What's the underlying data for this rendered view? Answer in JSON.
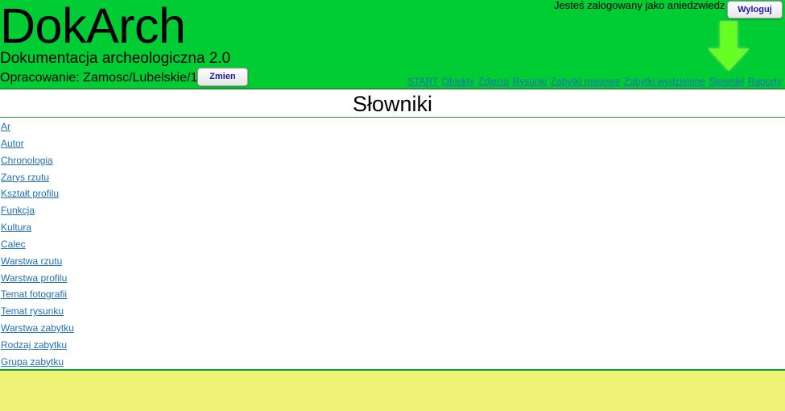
{
  "header": {
    "app_title": "DokArch",
    "app_subtitle": "Dokumentacja archeologiczna 2.0",
    "project_label": "Opracowanie: Zamosc/Lubelskie/1",
    "change_button": "Zmien",
    "user_status": "Jesteś zalogowany jako aniedzwiedz",
    "logout_button": "Wyloguj",
    "arrow_icon": "down-arrow-icon"
  },
  "nav": {
    "items": [
      {
        "label": "START"
      },
      {
        "label": "Obiekty"
      },
      {
        "label": "Zdjecia"
      },
      {
        "label": "Rysunki"
      },
      {
        "label": "Zabytki masowe"
      },
      {
        "label": "Zabytki wydzielone"
      },
      {
        "label": "Słowniki"
      },
      {
        "label": "Raporty"
      }
    ]
  },
  "main": {
    "heading": "Słowniki",
    "dictionaries": [
      "Ar",
      "Autor",
      "Chronologia",
      "Zarys rzutu",
      "Kształt profilu",
      "Funkcja",
      "Kultura",
      "Calec",
      "Warstwa rzutu",
      "Warstwa profilu",
      "Temat fotografii",
      "Temat rysunku",
      "Warstwa zabytku",
      "Rodzaj zabytku",
      "Grupa zabytku"
    ]
  },
  "colors": {
    "header_bg": "#00cc33",
    "footer_bg": "#eef275",
    "link": "#1f6fb5",
    "arrow": "#66ff22"
  }
}
